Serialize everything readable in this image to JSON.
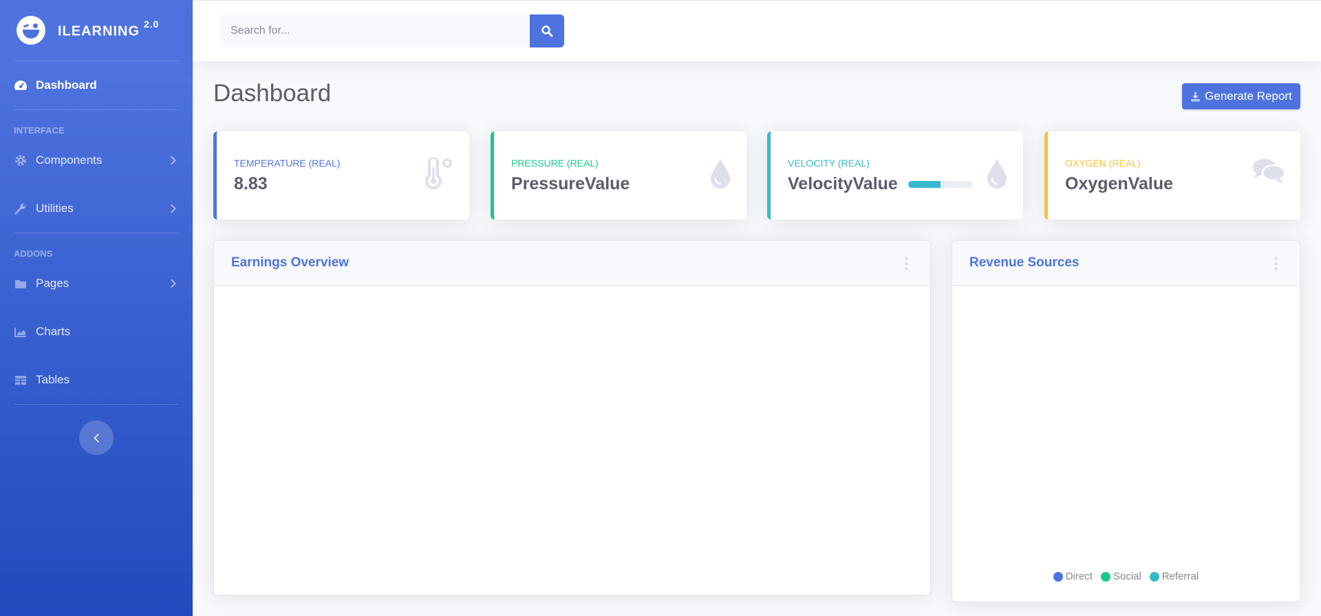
{
  "brand": {
    "name": "ILEARNING",
    "version": "2.0"
  },
  "sidebar": {
    "dashboard": "Dashboard",
    "heading_interface": "INTERFACE",
    "components": "Components",
    "utilities": "Utilities",
    "heading_addons": "ADDONS",
    "pages": "Pages",
    "charts": "Charts",
    "tables": "Tables"
  },
  "search": {
    "placeholder": "Search for..."
  },
  "page": {
    "title": "Dashboard",
    "report_button": "Generate Report"
  },
  "cards": [
    {
      "label": "TEMPERATURE (REAL)",
      "value": "8.83",
      "color": "#4e73df",
      "icon": "thermometer-icon"
    },
    {
      "label": "PRESSURE (REAL)",
      "value": "PressureValue",
      "color": "#1cc88a",
      "icon": "droplet-icon"
    },
    {
      "label": "VELOCITY (REAL)",
      "value": "VelocityValue",
      "color": "#36b9cc",
      "icon": "droplet-icon",
      "progress_percent": 50
    },
    {
      "label": "OXYGEN (REAL)",
      "value": "OxygenValue",
      "color": "#f6c23e",
      "icon": "comments-icon"
    }
  ],
  "earnings": {
    "title": "Earnings Overview"
  },
  "revenue": {
    "title": "Revenue Sources",
    "legend": [
      {
        "name": "Direct",
        "color": "#4e73df"
      },
      {
        "name": "Social",
        "color": "#1cc88a"
      },
      {
        "name": "Referral",
        "color": "#36b9cc"
      }
    ]
  }
}
